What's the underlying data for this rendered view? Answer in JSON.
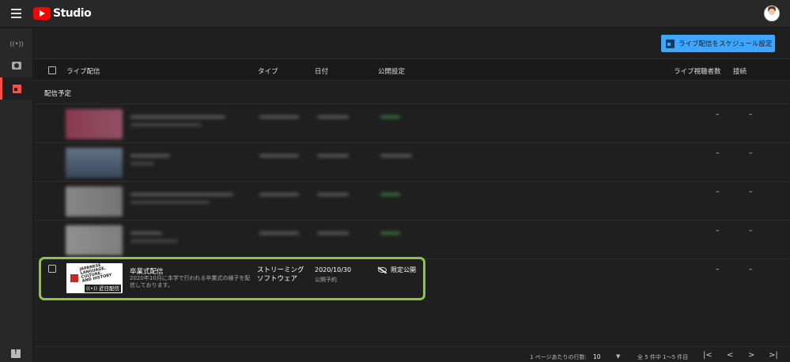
{
  "app": {
    "logo_text": "Studio"
  },
  "sidebar": {
    "items": [
      {
        "name": "live",
        "icon": "broadcast-icon",
        "glyph": "((•))"
      },
      {
        "name": "webcam",
        "icon": "camera-icon",
        "glyph": "📷"
      },
      {
        "name": "managed",
        "icon": "calendar-icon",
        "glyph": "▣",
        "active": true
      }
    ]
  },
  "actions": {
    "schedule_label": "ライブ配信をスケジュール設定"
  },
  "table": {
    "headers": {
      "live": "ライブ配信",
      "type": "タイプ",
      "date": "日付",
      "visibility": "公開設定",
      "viewers": "ライブ視聴者数",
      "connection": "接続"
    },
    "section_label": "配信予定",
    "dash": "–",
    "highlighted_row": {
      "title": "卒業式配信",
      "description": "2020年10月に本学で行われる卒業式の様子を配信しております。",
      "type": "ストリーミング ソフトウェア",
      "date": "2020/10/30",
      "date_status": "公開予約",
      "visibility": "限定公開",
      "thumb_text": "JAPANESE LANGUAGE, CULTURE, AND HISTORY",
      "badge": "((•)) 近日配信"
    }
  },
  "footer": {
    "rows_per_page_label": "1 ページあたりの行数:",
    "rows_per_page_value": "10",
    "range": "全 5 件中 1～5 件目",
    "first": "|<",
    "prev": "<",
    "next": ">",
    "last": ">|"
  },
  "colors": {
    "accent": "#3ea6ff",
    "active": "#ff4e45",
    "highlight": "#8fc640"
  }
}
